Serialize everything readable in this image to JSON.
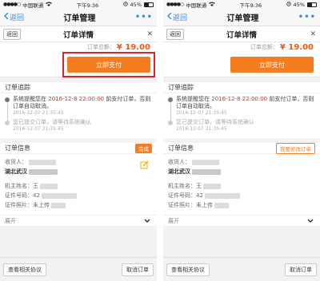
{
  "status_bar": {
    "carrier": "中国联通",
    "time": "下午9:36",
    "battery": "45%",
    "battery_level": 0.45
  },
  "nav": {
    "back_label": "返回",
    "title": "订单管理",
    "more_label": "•••"
  },
  "subheader": {
    "back_label": "返回",
    "title": "订单详情",
    "close_label": "✕"
  },
  "total": {
    "label": "订单总额：",
    "amount": "¥ 19.00"
  },
  "pay_button_label": "立即支付",
  "tracking": {
    "heading": "订单追踪",
    "events": [
      {
        "pre": "系统提醒您在",
        "highlight": "2016-12-8 22:00:00",
        "post": "前支付订单，否则订单自动取消。",
        "date": "2016-12-07 21:35:45"
      },
      {
        "text": "您已提交订单，请等待系统确认",
        "date": "2016-12-07 21:35:45"
      }
    ]
  },
  "order_info": {
    "heading": "订单信息",
    "left_badge": "完成",
    "right_badge": "我要修改订单",
    "receiver_label": "收货人：",
    "address_prefix": "湖北武汉",
    "owner_label": "机主姓名：",
    "owner_value": "王",
    "id_label": "证件号码：",
    "id_value": "42",
    "photo_label": "证件照片：",
    "photo_value": "未上传"
  },
  "expand_label": "展开",
  "footer": {
    "agreement_label": "查看相关协议",
    "cancel_label": "取消订单"
  },
  "colors": {
    "accent": "#f57c1f",
    "highlight_box": "#d9252a",
    "link": "#2d8cf0"
  }
}
